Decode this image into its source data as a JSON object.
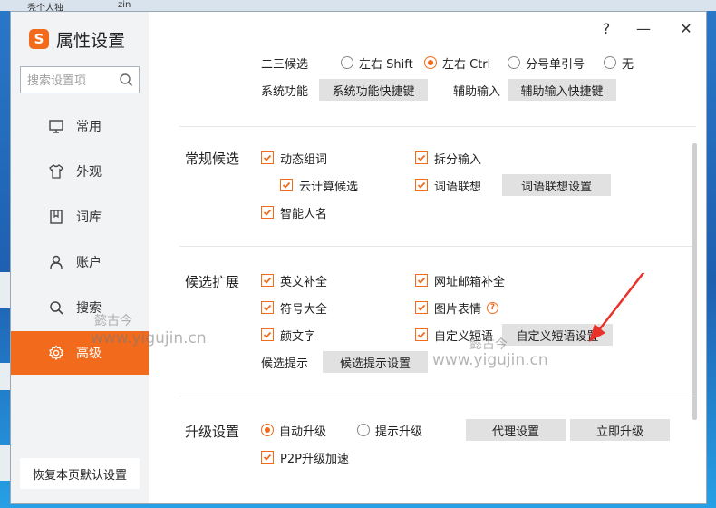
{
  "desktop": {
    "top_left": "秃个人独",
    "top_mid": "zin"
  },
  "window": {
    "app_title": "属性设置",
    "logo_letter": "S",
    "help": "?",
    "minimize": "—",
    "close": "✕",
    "accent": "#f26b1d"
  },
  "sidebar": {
    "search_placeholder": "搜索设置项",
    "items": [
      {
        "label": "常用",
        "icon": "monitor-icon"
      },
      {
        "label": "外观",
        "icon": "shirt-icon"
      },
      {
        "label": "词库",
        "icon": "dictionary-icon"
      },
      {
        "label": "账户",
        "icon": "user-icon"
      },
      {
        "label": "搜索",
        "icon": "search-icon"
      },
      {
        "label": "高级",
        "icon": "gear-icon",
        "active": true
      }
    ],
    "restore_label": "恢复本页默认设置"
  },
  "top_section": {
    "secondary_label": "二三候选",
    "options": [
      {
        "label": "左右 Shift",
        "selected": false
      },
      {
        "label": "左右 Ctrl",
        "selected": true
      },
      {
        "label": "分号单引号",
        "selected": false
      },
      {
        "label": "无",
        "selected": false
      }
    ],
    "system_label": "系统功能",
    "system_btn": "系统功能快捷键",
    "assist_label": "辅助输入",
    "assist_btn": "辅助输入快捷键"
  },
  "regular": {
    "title": "常规候选",
    "dynamic": "动态组词",
    "split": "拆分输入",
    "cloud": "云计算候选",
    "assoc": "词语联想",
    "assoc_btn": "词语联想设置",
    "smart_name": "智能人名"
  },
  "extension": {
    "title": "候选扩展",
    "english": "英文补全",
    "email": "网址邮箱补全",
    "symbol": "符号大全",
    "emoji": "图片表情",
    "kaomoji": "颜文字",
    "custom": "自定义短语",
    "custom_btn": "自定义短语设置",
    "hint_label": "候选提示",
    "hint_btn": "候选提示设置"
  },
  "upgrade": {
    "title": "升级设置",
    "auto": "自动升级",
    "prompt": "提示升级",
    "proxy_btn": "代理设置",
    "now_btn": "立即升级",
    "p2p": "P2P升级加速"
  },
  "watermarks": {
    "cn": "懿古今",
    "url": "www.yigujin.cn"
  }
}
